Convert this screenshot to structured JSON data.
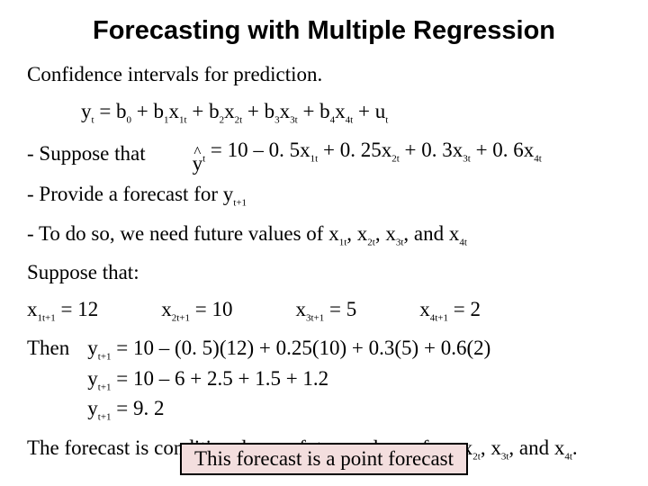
{
  "title": "Forecasting with Multiple Regression",
  "intro": "Confidence intervals for prediction.",
  "model_lhs": "y",
  "model_sub_t": "t",
  "model_rhs_parts": {
    "b0": "b",
    "b0s": "0",
    "b1": "b",
    "b1s": "1",
    "x1": "x",
    "x1s": "1t",
    "b2": "b",
    "b2s": "2",
    "x2": "x",
    "x2s": "2t",
    "b3": "b",
    "b3s": "3",
    "x3": "x",
    "x3s": "3t",
    "b4": "b",
    "b4s": "4",
    "x4": "x",
    "x4s": "4t",
    "u": "u",
    "us": "t"
  },
  "suppose_label": "- Suppose that",
  "yhat_y": "y",
  "yhat_sub": "t",
  "fitted": " = 10 – 0. 5x",
  "fitted_s1": "1t",
  "fitted_p2": " + 0. 25x",
  "fitted_s2": "2t",
  "fitted_p3": " + 0. 3x",
  "fitted_s3": "3t",
  "fitted_p4": " + 0. 6x",
  "fitted_s4": "4t",
  "provide_a": "- Provide a forecast for y",
  "provide_sub": "t+1",
  "todo_a": "- To do so, we need future values of x",
  "todo_s1": "1t",
  "todo_c": ", x",
  "todo_s2": "2t",
  "todo_s3": "3t",
  "todo_and": ", and x",
  "todo_s4": "4t",
  "suppose_that": "Suppose that:",
  "fx": {
    "x1": "x",
    "x1s": "1t+1",
    "x1v": " = 12",
    "x2": "x",
    "x2s": "2t+1",
    "x2v": " = 10",
    "x3": "x",
    "x3s": "3t+1",
    "x3v": " = 5",
    "x4": "x",
    "x4s": "4t+1",
    "x4v": " = 2"
  },
  "then_label": "Then",
  "calc": {
    "l1a": "y",
    "l1s": "t+1",
    "l1b": " = 10 – (0. 5)(12) + 0.25(10) + 0.3(5) + 0.6(2)",
    "l2a": "y",
    "l2s": "t+1",
    "l2b": " = 10 – 6 + 2.5 + 1.5 + 1.2",
    "l3a": "y",
    "l3s": "t+1",
    "l3b": " = 9. 2"
  },
  "concl_a": "The forecast is conditional upon future values of x",
  "concl_s1": "1t",
  "concl_c": ", x",
  "concl_s2": "2t",
  "concl_s3": "3t",
  "concl_and": ", and x",
  "concl_s4": "4t",
  "concl_dot": ".",
  "boxed": "This forecast is a point forecast"
}
